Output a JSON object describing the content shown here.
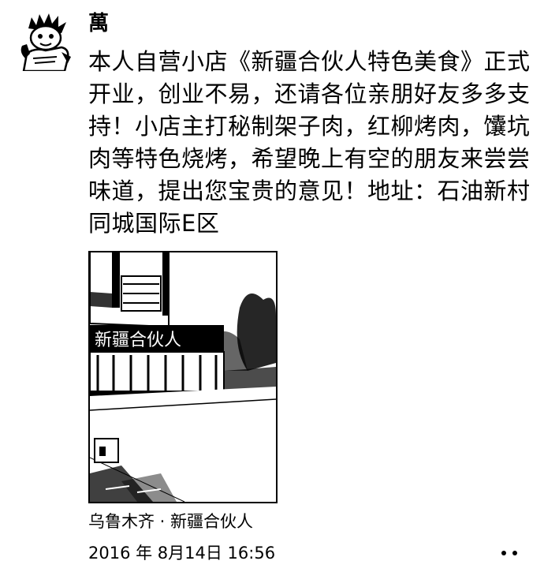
{
  "post": {
    "username": "萬",
    "text": "本人自营小店《新疆合伙人特色美食》正式开业，创业不易，还请各位亲朋好友多多支持！小店主打秘制架子肉，红柳烤肉，馕坑肉等特色烧烤，希望晚上有空的朋友来尝尝味道，提出您宝贵的意见！地址：石油新村同城国际E区",
    "photo_sign_text": "新疆合伙人",
    "location": "乌鲁木齐 · 新疆合伙人",
    "timestamp": "2016 年 8月14日  16:56"
  },
  "icons": {
    "avatar": "cartoon-avatar-icon",
    "more": "more-dots-icon"
  },
  "colors": {
    "text": "#000000",
    "background": "#ffffff"
  }
}
